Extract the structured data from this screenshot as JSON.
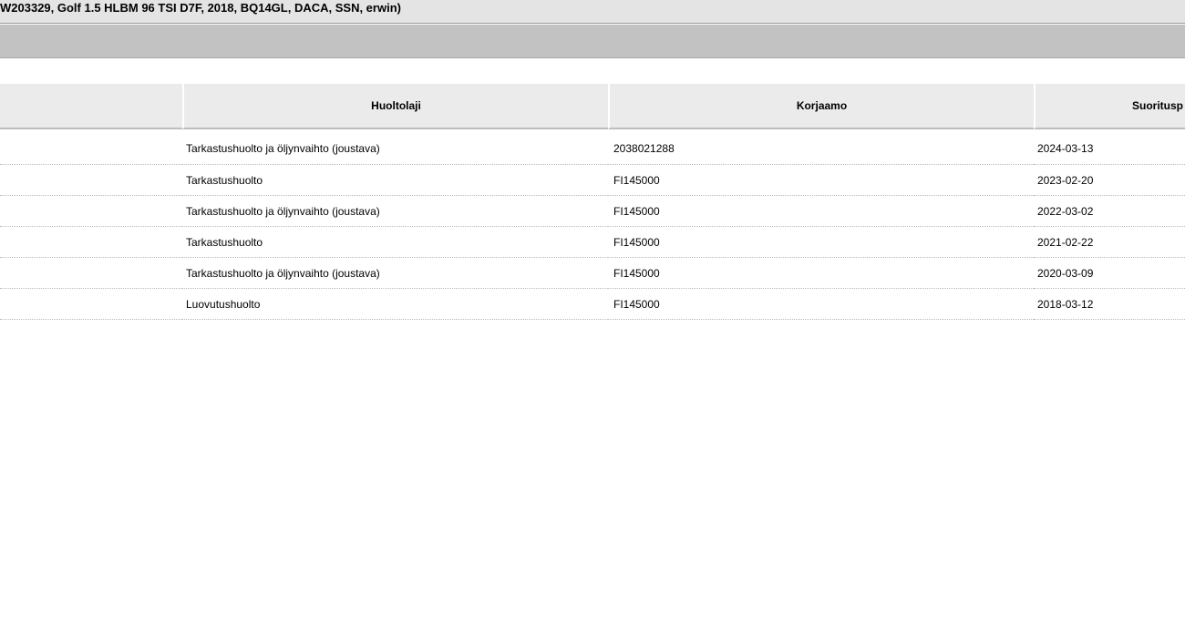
{
  "window": {
    "title": "W203329, Golf 1.5 HLBM 96 TSI D7F, 2018, BQ14GL, DACA, SSN, erwin)"
  },
  "table": {
    "columns": [
      "",
      "Huoltolaji",
      "Korjaamo",
      "Suoritusp"
    ],
    "rows": [
      {
        "service": "Tarkastushuolto ja öljynvaihto (joustava)",
        "workshop": "2038021288",
        "date": "2024-03-13"
      },
      {
        "service": "Tarkastushuolto",
        "workshop": "FI145000",
        "date": "2023-02-20"
      },
      {
        "service": "Tarkastushuolto ja öljynvaihto (joustava)",
        "workshop": "FI145000",
        "date": "2022-03-02"
      },
      {
        "service": "Tarkastushuolto",
        "workshop": "FI145000",
        "date": "2021-02-22"
      },
      {
        "service": "Tarkastushuolto ja öljynvaihto (joustava)",
        "workshop": "FI145000",
        "date": "2020-03-09"
      },
      {
        "service": "Luovutushuolto",
        "workshop": "FI145000",
        "date": "2018-03-12"
      }
    ]
  }
}
